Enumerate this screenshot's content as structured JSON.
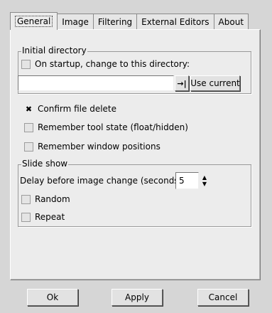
{
  "tabs": [
    "General",
    "Image",
    "Filtering",
    "External Editors",
    "About"
  ],
  "initial_directory": {
    "title": "Initial directory",
    "startup_label": "On startup, change to this directory:",
    "startup_checked": false,
    "path_value": "",
    "use_current_label": "Use current"
  },
  "options": {
    "confirm_delete_label": "Confirm file delete",
    "confirm_delete_checked": true,
    "remember_tool_label": "Remember tool state (float/hidden)",
    "remember_tool_checked": false,
    "remember_window_label": "Remember window positions",
    "remember_window_checked": false
  },
  "slideshow": {
    "title": "Slide show",
    "delay_label": "Delay before image change (seconds):",
    "delay_value": "5",
    "random_label": "Random",
    "random_checked": false,
    "repeat_label": "Repeat",
    "repeat_checked": false
  },
  "buttons": {
    "ok": "Ok",
    "apply": "Apply",
    "cancel": "Cancel"
  },
  "icons": {
    "checkmark": "✖",
    "path_arrow": "→|",
    "spin_up": "▲",
    "spin_down": "▼"
  }
}
